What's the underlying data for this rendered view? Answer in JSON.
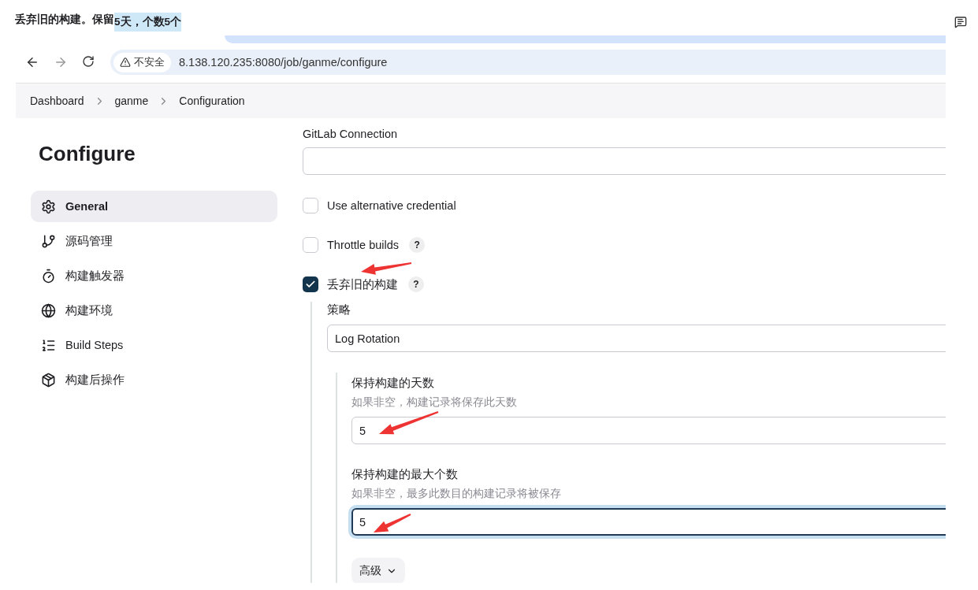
{
  "caption": {
    "text": "丢弃旧的构建。保留",
    "highlighted": "5天，个数5个"
  },
  "browser": {
    "security": "不安全",
    "url": "8.138.120.235:8080/job/ganme/configure"
  },
  "breadcrumbs": [
    "Dashboard",
    "ganme",
    "Configuration"
  ],
  "sidebar": {
    "title": "Configure",
    "items": [
      {
        "label": "General",
        "selected": true
      },
      {
        "label": "源码管理",
        "selected": false
      },
      {
        "label": "构建触发器",
        "selected": false
      },
      {
        "label": "构建环境",
        "selected": false
      },
      {
        "label": "Build Steps",
        "selected": false
      },
      {
        "label": "构建后操作",
        "selected": false
      }
    ]
  },
  "form": {
    "gitlab_connection": {
      "label": "GitLab Connection"
    },
    "checkboxes": [
      {
        "label": "Use alternative credential",
        "checked": false
      },
      {
        "label": "Throttle builds",
        "checked": false,
        "help": "?"
      },
      {
        "label": "丢弃旧的构建",
        "checked": true,
        "help": "?"
      }
    ],
    "strategy": {
      "label": "策略",
      "value": "Log Rotation"
    },
    "fields": [
      {
        "label": "保持构建的天数",
        "hint": "如果非空，构建记录将保存此天数",
        "value": "5",
        "focused": false
      },
      {
        "label": "保持构建的最大个数",
        "hint": "如果非空，最多此数目的构建记录将被保存",
        "value": "5",
        "focused": true
      }
    ],
    "advanced_button": "高级"
  }
}
